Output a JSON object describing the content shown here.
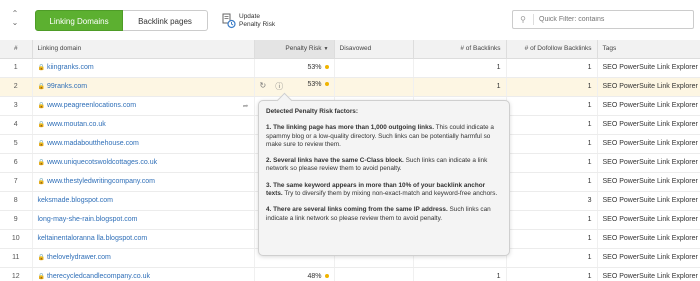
{
  "toolbar": {
    "collapse_icon": "chevron-up-down-icon",
    "tabs": [
      {
        "label": "Linking Domains",
        "active": true
      },
      {
        "label": "Backlink pages",
        "active": false
      }
    ],
    "update_label_line1": "Update",
    "update_label_line2": "Penalty Risk",
    "filter_placeholder": "Quick Filter: contains"
  },
  "table": {
    "columns": [
      "#",
      "Linking domain",
      "Penalty Risk",
      "Disavowed",
      "# of Backlinks",
      "# of Dofollow Backlinks",
      "Tags"
    ],
    "rows": [
      {
        "n": "1",
        "domain": "kiingranks.com",
        "lock": true,
        "risk": "53%",
        "dot": true,
        "backlinks": "1",
        "dofollow": "1",
        "tags": "SEO PowerSuite Link Explorer"
      },
      {
        "n": "2",
        "domain": "99ranks.com",
        "lock": true,
        "risk": "53%",
        "dot": true,
        "backlinks": "1",
        "dofollow": "1",
        "tags": "SEO PowerSuite Link Explorer"
      },
      {
        "n": "3",
        "domain": "www.peagreenlocations.com",
        "lock": true,
        "risk": "",
        "dot": false,
        "backlinks": "",
        "dofollow": "1",
        "tags": "SEO PowerSuite Link Explorer"
      },
      {
        "n": "4",
        "domain": "www.moutan.co.uk",
        "lock": true,
        "risk": "",
        "dot": false,
        "backlinks": "",
        "dofollow": "1",
        "tags": "SEO PowerSuite Link Explorer"
      },
      {
        "n": "5",
        "domain": "www.madaboutthehouse.com",
        "lock": true,
        "risk": "",
        "dot": false,
        "backlinks": "",
        "dofollow": "1",
        "tags": "SEO PowerSuite Link Explorer"
      },
      {
        "n": "6",
        "domain": "www.uniquecotswoldcottages.co.uk",
        "lock": true,
        "risk": "",
        "dot": false,
        "backlinks": "",
        "dofollow": "1",
        "tags": "SEO PowerSuite Link Explorer"
      },
      {
        "n": "7",
        "domain": "www.thestyledwritingcompany.com",
        "lock": true,
        "risk": "",
        "dot": false,
        "backlinks": "",
        "dofollow": "1",
        "tags": "SEO PowerSuite Link Explorer"
      },
      {
        "n": "8",
        "domain": "keksmade.blogspot.com",
        "lock": false,
        "risk": "",
        "dot": false,
        "backlinks": "",
        "dofollow": "3",
        "tags": "SEO PowerSuite Link Explorer"
      },
      {
        "n": "9",
        "domain": "long-may-she-rain.blogspot.com",
        "lock": false,
        "risk": "",
        "dot": false,
        "backlinks": "",
        "dofollow": "1",
        "tags": "SEO PowerSuite Link Explorer"
      },
      {
        "n": "10",
        "domain": "keltainentaloranna lla.blogspot.com",
        "lock": false,
        "risk": "",
        "dot": false,
        "backlinks": "",
        "dofollow": "1",
        "tags": "SEO PowerSuite Link Explorer"
      },
      {
        "n": "11",
        "domain": "thelovelydrawer.com",
        "lock": true,
        "risk": "",
        "dot": false,
        "backlinks": "",
        "dofollow": "1",
        "tags": "SEO PowerSuite Link Explorer"
      },
      {
        "n": "12",
        "domain": "therecycledcandlecompany.co.uk",
        "lock": true,
        "risk": "48%",
        "dot": true,
        "backlinks": "1",
        "dofollow": "1",
        "tags": "SEO PowerSuite Link Explorer"
      }
    ]
  },
  "tooltip": {
    "title": "Detected Penalty Risk factors:",
    "items": [
      {
        "bold": "1. The linking page has more than 1,000 outgoing links.",
        "text": " This could indicate a spammy blog or a low-quality directory. Such links can be potentially harmful so make sure to review them."
      },
      {
        "bold": "2. Several links have the same C-Class block.",
        "text": " Such links can indicate a link network so please review them to avoid penalty."
      },
      {
        "bold": "3. The same keyword appears in more than 10% of your backlink anchor texts.",
        "text": " Try to diversify them by mixing non-exact-match and keyword-free anchors."
      },
      {
        "bold": "4. There are several links coming from the same IP address.",
        "text": " Such links can indicate a link network so please review them to avoid penalty."
      }
    ]
  },
  "colors": {
    "accent": "#5cb030",
    "link": "#2f6fb8",
    "risk_dot": "#f0b400"
  }
}
